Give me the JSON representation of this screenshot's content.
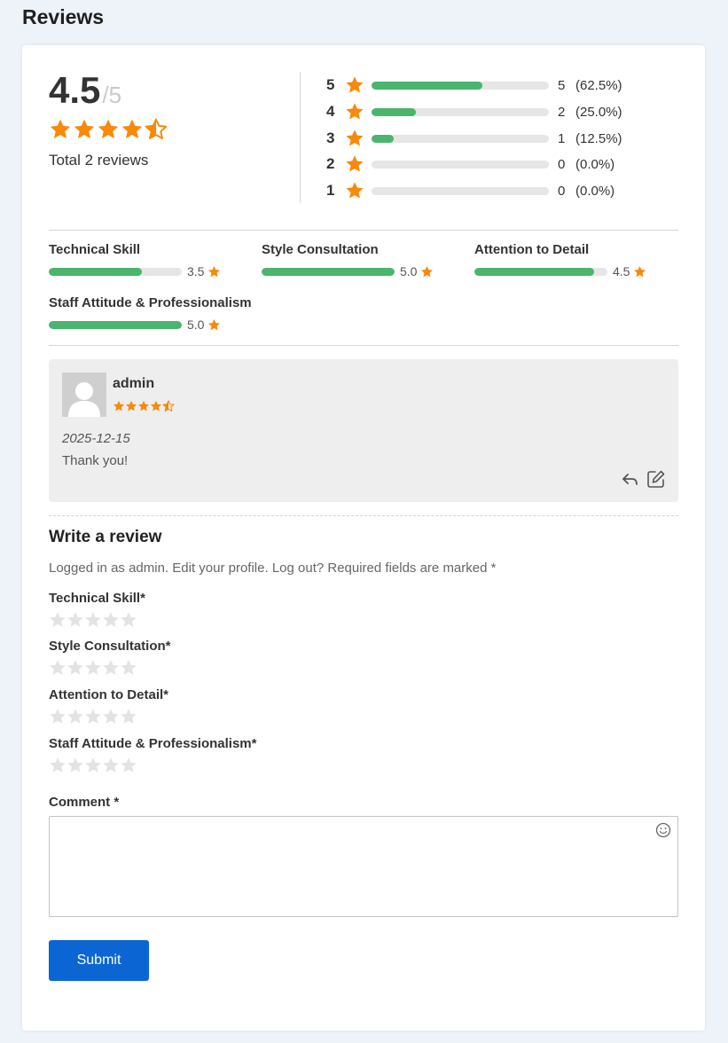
{
  "page": {
    "title": "Reviews"
  },
  "summary": {
    "average": "4.5",
    "max": "/5",
    "rating_value": 4.5,
    "total_text": "Total 2 reviews",
    "distribution": [
      {
        "stars": "5",
        "count": "5",
        "percent": "(62.5%)",
        "fill": 0.625
      },
      {
        "stars": "4",
        "count": "2",
        "percent": "(25.0%)",
        "fill": 0.25
      },
      {
        "stars": "3",
        "count": "1",
        "percent": "(12.5%)",
        "fill": 0.125
      },
      {
        "stars": "2",
        "count": "0",
        "percent": "(0.0%)",
        "fill": 0
      },
      {
        "stars": "1",
        "count": "0",
        "percent": "(0.0%)",
        "fill": 0
      }
    ]
  },
  "criteria": [
    {
      "label": "Technical Skill",
      "value": "3.5",
      "fill": 0.7
    },
    {
      "label": "Style Consultation",
      "value": "5.0",
      "fill": 1.0
    },
    {
      "label": "Attention to Detail",
      "value": "4.5",
      "fill": 0.9
    },
    {
      "label": "Staff Attitude & Professionalism",
      "value": "5.0",
      "fill": 1.0
    }
  ],
  "review": {
    "author": "admin",
    "rating": 4.5,
    "date": "2025-12-15",
    "text": "Thank you!"
  },
  "form": {
    "title": "Write a review",
    "logged_in_text": "Logged in as admin. Edit your profile. Log out? Required fields are marked *",
    "rating_fields": [
      {
        "label": "Technical Skill*"
      },
      {
        "label": "Style Consultation*"
      },
      {
        "label": "Attention to Detail*"
      },
      {
        "label": "Staff Attitude & Professionalism*"
      }
    ],
    "comment_label": "Comment *",
    "comment_value": "",
    "submit_label": "Submit"
  },
  "colors": {
    "star": "#f7890b",
    "star_empty": "#e3e3e3",
    "bar_fill": "#4bb46e",
    "bar_track": "#e6e6e6",
    "submit": "#0b66d4",
    "page_bg": "#eef2f9"
  },
  "icons": {
    "star": "star-icon",
    "half_star": "star-half-icon",
    "avatar": "user-avatar-icon",
    "reply": "reply-icon",
    "edit": "edit-icon",
    "emoji": "emoji-icon"
  }
}
